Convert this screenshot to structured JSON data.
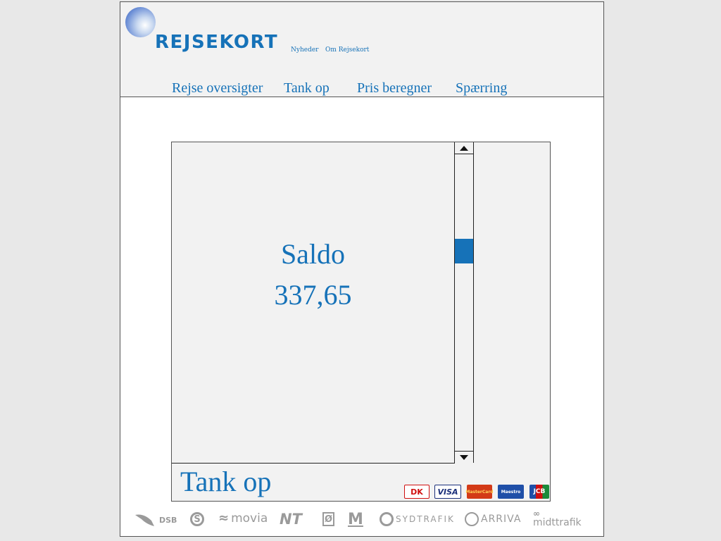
{
  "header": {
    "logo_text": "REJSEKORT",
    "small_links": [
      "Nyheder",
      "Om Rejsekort"
    ],
    "nav": [
      "Rejse oversigter",
      "Tank op",
      "Pris beregner",
      "Spærring"
    ]
  },
  "balance": {
    "label": "Saldo",
    "value": "337,65"
  },
  "topup": {
    "label": "Tank op"
  },
  "cards": {
    "dk": "DK",
    "visa": "VISA",
    "mastercard": "MasterCard",
    "maestro": "Maestro",
    "jcb": "JCB"
  },
  "operators": [
    "DSB",
    "S",
    "movia",
    "NT",
    "Ø",
    "M",
    "SYDTRAFIK",
    "ARRIVA",
    "midttrafik"
  ],
  "colors": {
    "brand_blue": "#1672b8",
    "panel_gray": "#f2f2f2",
    "operator_gray": "#9a9a9a"
  }
}
